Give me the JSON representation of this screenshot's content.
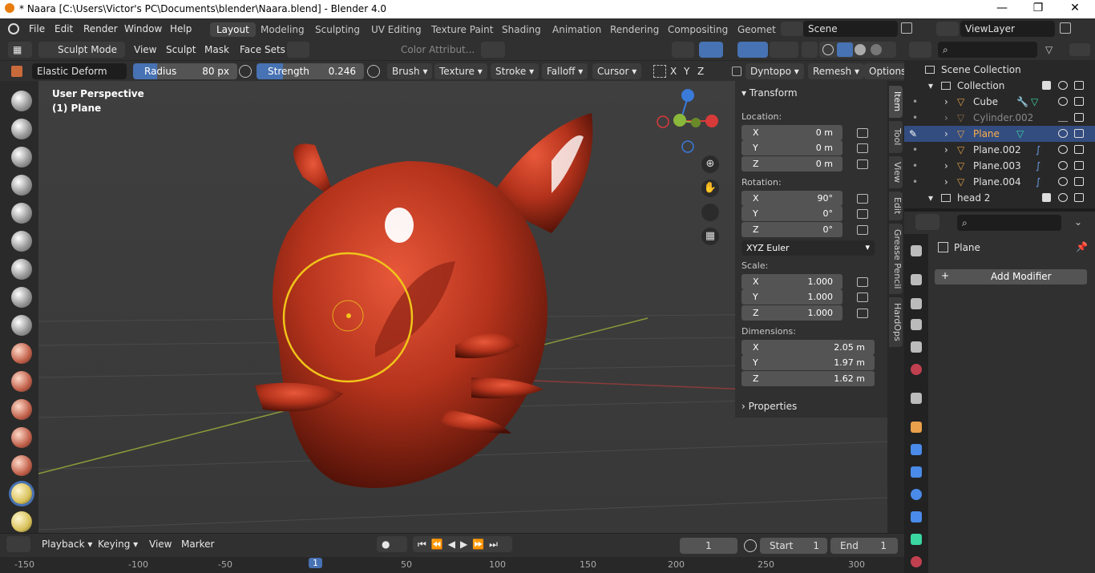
{
  "window": {
    "title": "* Naara [C:\\Users\\Victor's PC\\Documents\\blender\\Naara.blend] - Blender 4.0",
    "minimize": "—",
    "restore": "❐",
    "close": "✕"
  },
  "menu": [
    "File",
    "Edit",
    "Render",
    "Window",
    "Help"
  ],
  "workspaces": [
    "Layout",
    "Modeling",
    "Sculpting",
    "UV Editing",
    "Texture Paint",
    "Shading",
    "Animation",
    "Rendering",
    "Compositing",
    "Geomet"
  ],
  "active_workspace": "Layout",
  "scene": "Scene",
  "view_layer": "ViewLayer",
  "header1": {
    "mode": "Sculpt Mode",
    "menus": [
      "View",
      "Sculpt",
      "Mask",
      "Face Sets"
    ],
    "color_attr": "Color Attribut..."
  },
  "header2": {
    "brush_name": "Elastic Deform",
    "radius_label": "Radius",
    "radius_value": "80 px",
    "strength_label": "Strength",
    "strength_value": "0.246",
    "strength_fraction": 0.246,
    "dropdowns": [
      "Brush",
      "Texture",
      "Stroke",
      "Falloff",
      "Cursor"
    ],
    "sym_axes": [
      "X",
      "Y",
      "Z"
    ],
    "dyntopo": "Dyntopo",
    "remesh": "Remesh",
    "options": "Options"
  },
  "viewport": {
    "perspective": "User Perspective",
    "object": "(1) Plane"
  },
  "npanel": {
    "transform": "Transform",
    "location_label": "Location:",
    "location": [
      {
        "axis": "X",
        "value": "0 m"
      },
      {
        "axis": "Y",
        "value": "0 m"
      },
      {
        "axis": "Z",
        "value": "0 m"
      }
    ],
    "rotation_label": "Rotation:",
    "rotation": [
      {
        "axis": "X",
        "value": "90°"
      },
      {
        "axis": "Y",
        "value": "0°"
      },
      {
        "axis": "Z",
        "value": "0°"
      }
    ],
    "rotation_mode": "XYZ Euler",
    "scale_label": "Scale:",
    "scale": [
      {
        "axis": "X",
        "value": "1.000"
      },
      {
        "axis": "Y",
        "value": "1.000"
      },
      {
        "axis": "Z",
        "value": "1.000"
      }
    ],
    "dimensions_label": "Dimensions:",
    "dimensions": [
      {
        "axis": "X",
        "value": "2.05 m"
      },
      {
        "axis": "Y",
        "value": "1.97 m"
      },
      {
        "axis": "Z",
        "value": "1.62 m"
      }
    ],
    "properties": "Properties"
  },
  "sidebar_tabs": [
    "Item",
    "Tool",
    "View",
    "Edit",
    "Grease Pencil",
    "HardOps"
  ],
  "outliner": {
    "scene_collection": "Scene Collection",
    "collection": "Collection",
    "items": [
      "Cube",
      "Cylinder.002",
      "Plane",
      "Plane.002",
      "Plane.003",
      "Plane.004"
    ],
    "head": "head 2"
  },
  "properties": {
    "object_name": "Plane",
    "add_modifier": "Add Modifier"
  },
  "timeline": {
    "playback": "Playback",
    "keying": "Keying",
    "view": "View",
    "marker": "Marker",
    "current_frame": "1",
    "start_label": "Start",
    "start": "1",
    "end_label": "End",
    "end": "1",
    "ruler": [
      "-150",
      "-100",
      "-50",
      "1",
      "50",
      "100",
      "150",
      "200",
      "250",
      "300"
    ]
  },
  "colors": {
    "accent": "#4772b3",
    "brush_circle": "#f0c419",
    "mesh": "#b5331c"
  }
}
